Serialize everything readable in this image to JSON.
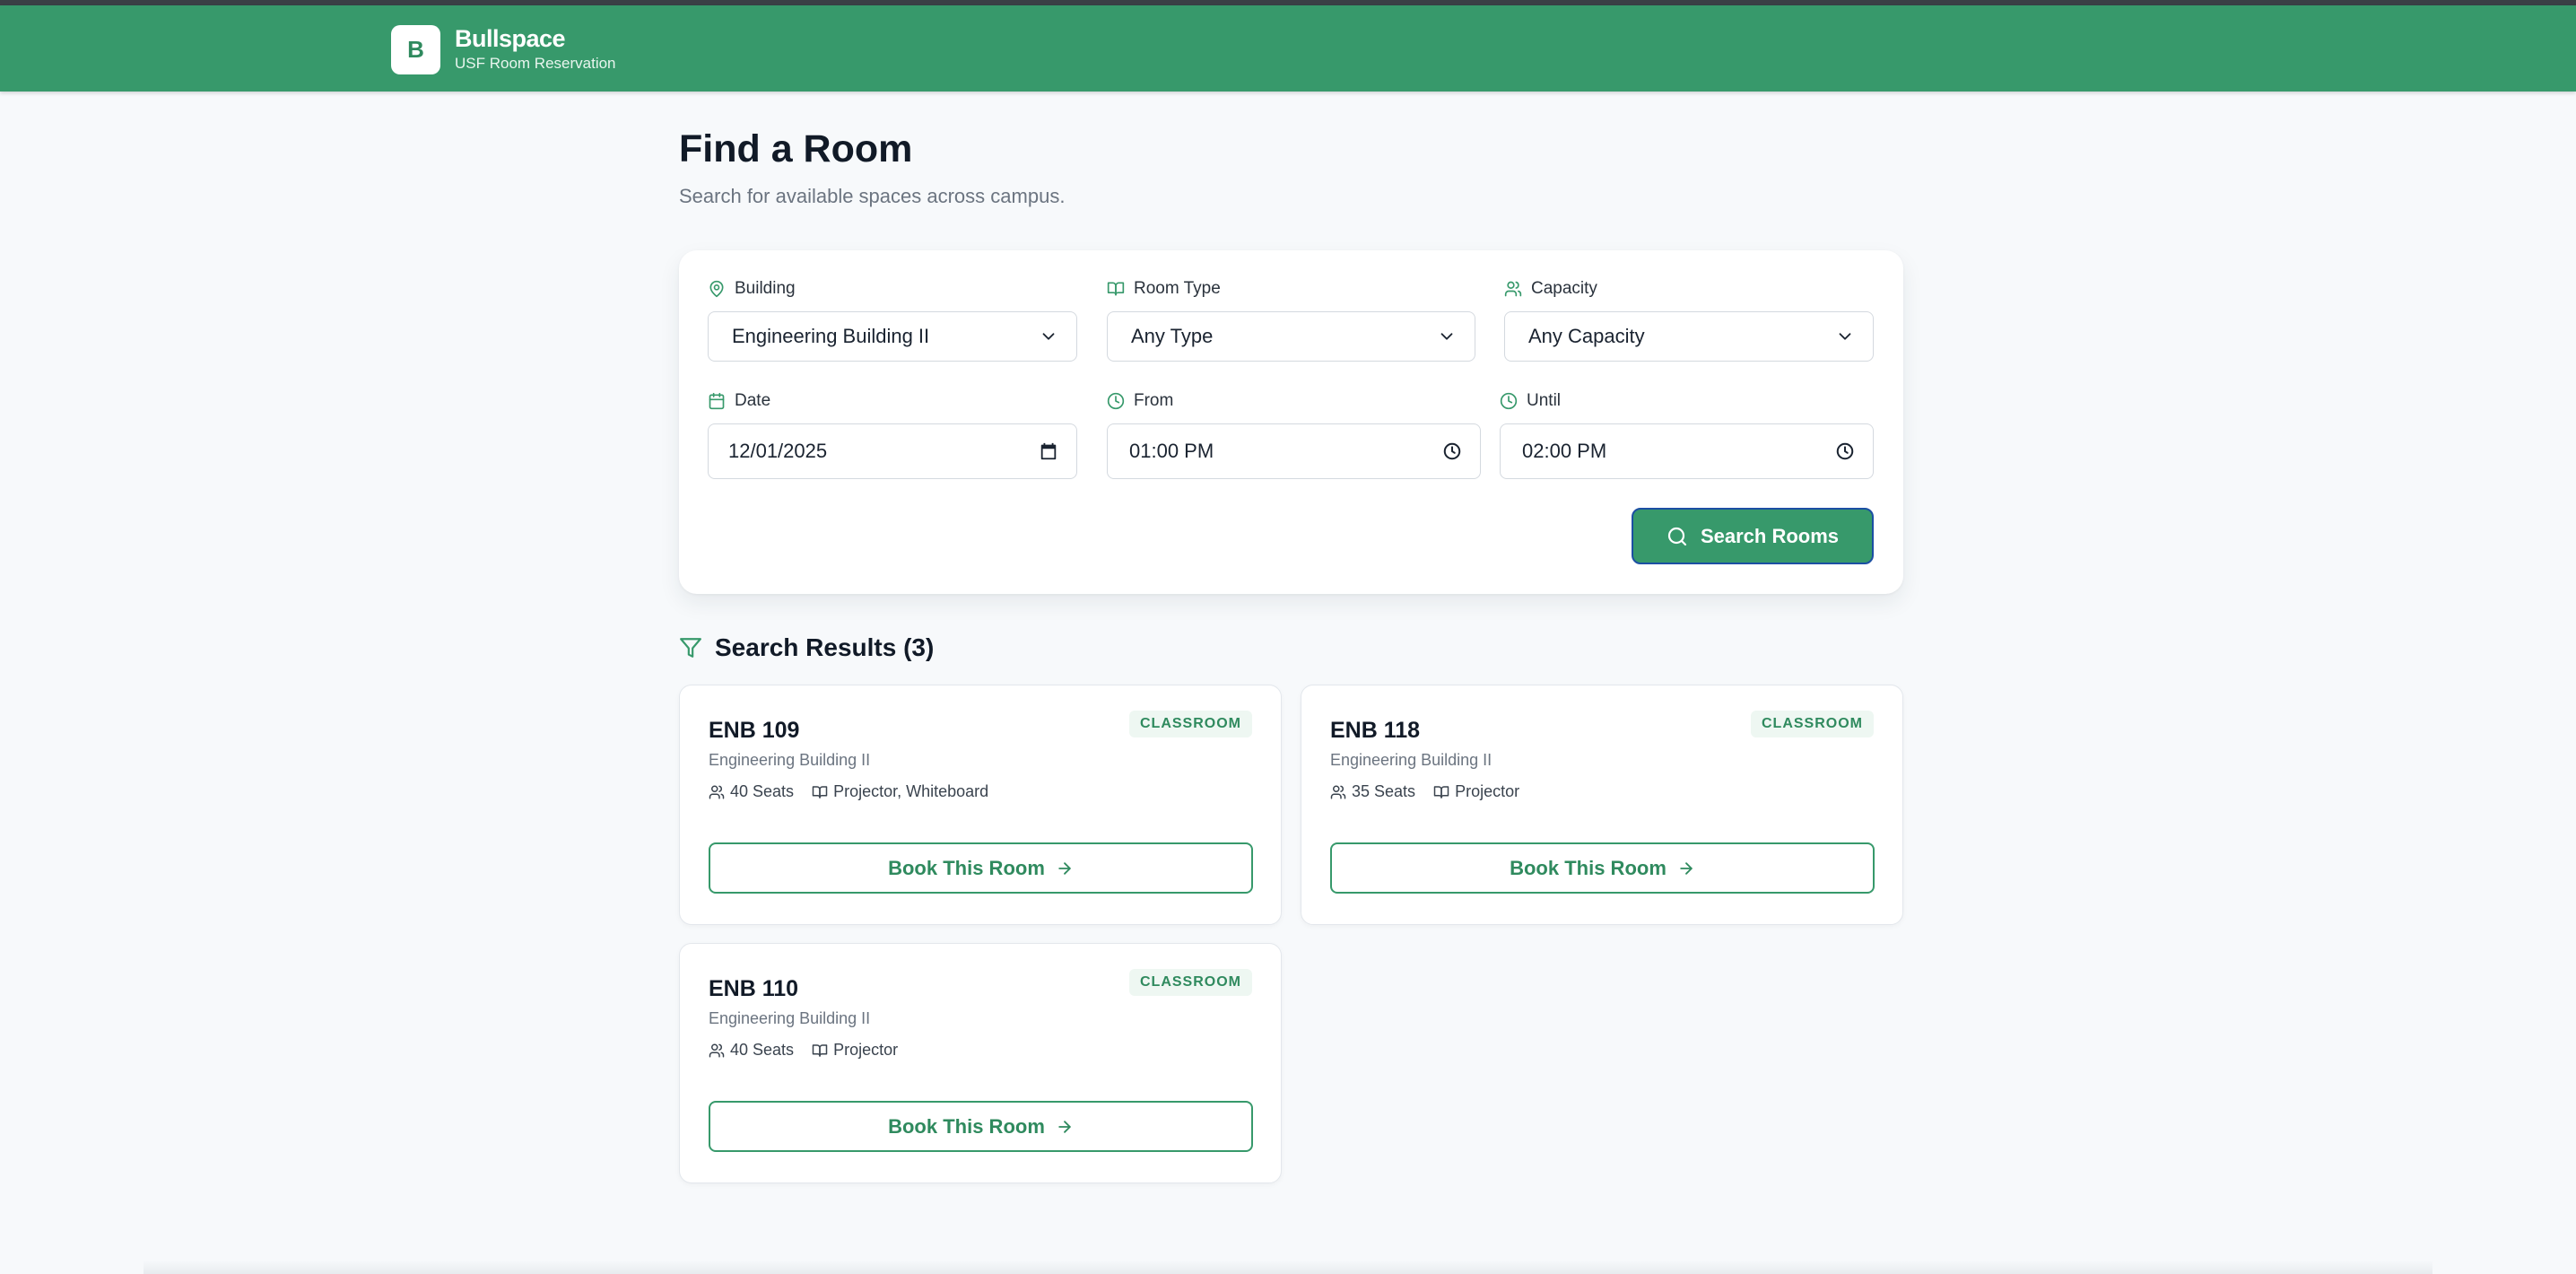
{
  "header": {
    "logo_letter": "B",
    "brand_name": "Bullspace",
    "brand_sub": "USF Room Reservation",
    "color": "#37996b"
  },
  "page": {
    "title": "Find a Room",
    "subtitle": "Search for available spaces across campus."
  },
  "search": {
    "building": {
      "label": "Building",
      "value": "Engineering Building II",
      "icon": "map-pin-icon"
    },
    "room_type": {
      "label": "Room Type",
      "value": "Any Type",
      "icon": "book-open-icon"
    },
    "capacity": {
      "label": "Capacity",
      "value": "Any Capacity",
      "icon": "users-icon"
    },
    "date": {
      "label": "Date",
      "value": "12/01/2025",
      "icon": "calendar-icon"
    },
    "from": {
      "label": "From",
      "value": "01:00 PM",
      "icon": "clock-icon"
    },
    "until": {
      "label": "Until",
      "value": "02:00 PM",
      "icon": "clock-icon"
    },
    "button_label": "Search Rooms"
  },
  "results": {
    "heading": "Search Results (3)",
    "rooms": [
      {
        "name": "ENB 109",
        "building": "Engineering Building II",
        "seats": "40 Seats",
        "features": "Projector, Whiteboard",
        "type": "CLASSROOM",
        "button": "Book This Room"
      },
      {
        "name": "ENB 118",
        "building": "Engineering Building II",
        "seats": "35 Seats",
        "features": "Projector",
        "type": "CLASSROOM",
        "button": "Book This Room"
      },
      {
        "name": "ENB 110",
        "building": "Engineering Building II",
        "seats": "40 Seats",
        "features": "Projector",
        "type": "CLASSROOM",
        "button": "Book This Room"
      }
    ]
  },
  "colors": {
    "primary": "#37996b",
    "primary_text": "#2f8a5e",
    "focus_ring": "#1c4fa3",
    "background": "#f7f9fb"
  }
}
